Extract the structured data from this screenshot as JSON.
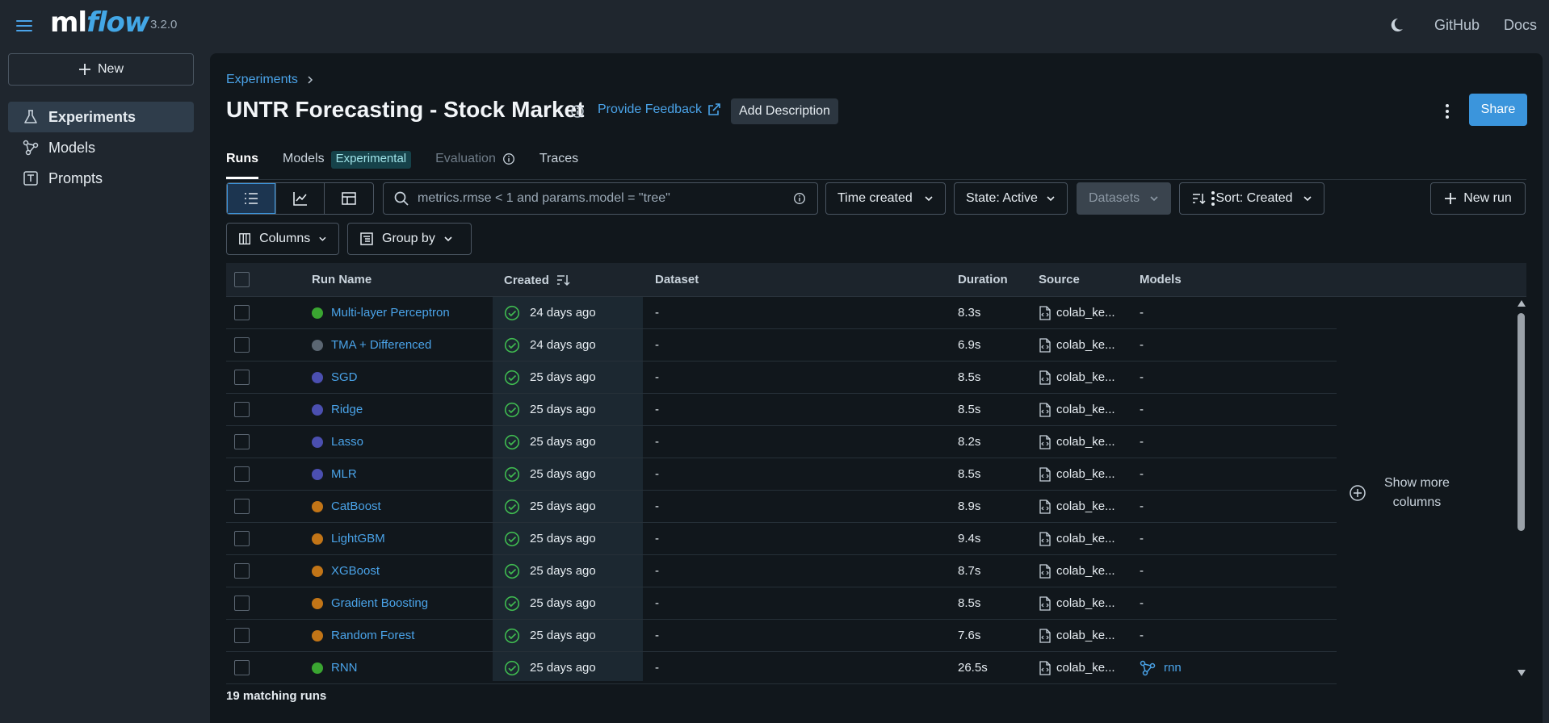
{
  "app": {
    "logo_ml": "ml",
    "logo_flow": "flow",
    "version": "3.2.0",
    "links": {
      "github": "GitHub",
      "docs": "Docs"
    }
  },
  "sidebar": {
    "new_label": "New",
    "items": [
      {
        "label": "Experiments",
        "icon": "beaker-icon",
        "active": true
      },
      {
        "label": "Models",
        "icon": "models-icon",
        "active": false
      },
      {
        "label": "Prompts",
        "icon": "prompts-icon",
        "active": false
      }
    ]
  },
  "header": {
    "breadcrumb": "Experiments",
    "title": "UNTR Forecasting - Stock Market",
    "feedback_label": "Provide Feedback",
    "add_description_label": "Add Description",
    "share_label": "Share"
  },
  "tabs": [
    {
      "label": "Runs",
      "active": true
    },
    {
      "label": "Models",
      "tag": "Experimental"
    },
    {
      "label": "Evaluation",
      "disabled": true
    },
    {
      "label": "Traces"
    }
  ],
  "toolbar": {
    "search_placeholder": "metrics.rmse < 1 and params.model = \"tree\"",
    "time_created": "Time created",
    "state": "State: Active",
    "datasets": "Datasets",
    "sort": "Sort: Created",
    "new_run": "New run",
    "columns": "Columns",
    "group_by": "Group by"
  },
  "table": {
    "headers": {
      "run_name": "Run Name",
      "created": "Created",
      "dataset": "Dataset",
      "duration": "Duration",
      "source": "Source",
      "models": "Models"
    },
    "rows": [
      {
        "name": "Multi-layer Perceptron",
        "color": "#3aa531",
        "created": "24 days ago",
        "dataset": "-",
        "duration": "8.3s",
        "source": "colab_ke...",
        "models": "-"
      },
      {
        "name": "TMA + Differenced",
        "color": "#5b6672",
        "created": "24 days ago",
        "dataset": "-",
        "duration": "6.9s",
        "source": "colab_ke...",
        "models": "-"
      },
      {
        "name": "SGD",
        "color": "#4b4fb0",
        "created": "25 days ago",
        "dataset": "-",
        "duration": "8.5s",
        "source": "colab_ke...",
        "models": "-"
      },
      {
        "name": "Ridge",
        "color": "#4b4fb0",
        "created": "25 days ago",
        "dataset": "-",
        "duration": "8.5s",
        "source": "colab_ke...",
        "models": "-"
      },
      {
        "name": "Lasso",
        "color": "#4b4fb0",
        "created": "25 days ago",
        "dataset": "-",
        "duration": "8.2s",
        "source": "colab_ke...",
        "models": "-"
      },
      {
        "name": "MLR",
        "color": "#4b4fb0",
        "created": "25 days ago",
        "dataset": "-",
        "duration": "8.5s",
        "source": "colab_ke...",
        "models": "-"
      },
      {
        "name": "CatBoost",
        "color": "#c27517",
        "created": "25 days ago",
        "dataset": "-",
        "duration": "8.9s",
        "source": "colab_ke...",
        "models": "-"
      },
      {
        "name": "LightGBM",
        "color": "#c27517",
        "created": "25 days ago",
        "dataset": "-",
        "duration": "9.4s",
        "source": "colab_ke...",
        "models": "-"
      },
      {
        "name": "XGBoost",
        "color": "#c27517",
        "created": "25 days ago",
        "dataset": "-",
        "duration": "8.7s",
        "source": "colab_ke...",
        "models": "-"
      },
      {
        "name": "Gradient Boosting",
        "color": "#c27517",
        "created": "25 days ago",
        "dataset": "-",
        "duration": "8.5s",
        "source": "colab_ke...",
        "models": "-"
      },
      {
        "name": "Random Forest",
        "color": "#c27517",
        "created": "25 days ago",
        "dataset": "-",
        "duration": "7.6s",
        "source": "colab_ke...",
        "models": "-"
      },
      {
        "name": "RNN",
        "color": "#3aa531",
        "created": "25 days ago",
        "dataset": "-",
        "duration": "26.5s",
        "source": "colab_ke...",
        "models": "rnn",
        "model_link": true
      }
    ],
    "show_more_columns": [
      "Show more",
      "columns"
    ],
    "footer": "19 matching runs"
  },
  "colors": {
    "accent": "#3b95dc",
    "link": "#4aa3e8",
    "success": "#3fb950"
  }
}
